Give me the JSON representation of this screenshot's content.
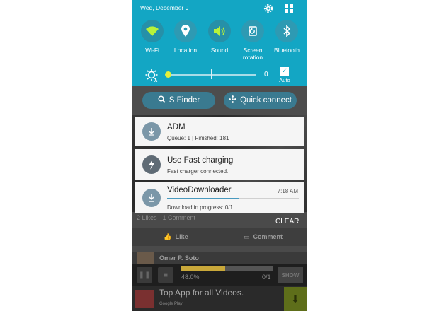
{
  "status": {
    "date": "Wed, December 9"
  },
  "quick_settings": [
    {
      "label": "Wi-Fi",
      "icon": "wifi-icon",
      "on": true
    },
    {
      "label": "Location",
      "icon": "location-icon",
      "on": false
    },
    {
      "label": "Sound",
      "icon": "sound-icon",
      "on": true
    },
    {
      "label": "Screen rotation",
      "icon": "screen-rotation-icon",
      "on": false
    },
    {
      "label": "Bluetooth",
      "icon": "bluetooth-icon",
      "on": false
    }
  ],
  "brightness": {
    "value": "0",
    "auto_label": "Auto",
    "auto_checked": true
  },
  "buttons": {
    "s_finder": "S Finder",
    "quick_connect": "Quick connect"
  },
  "notifications": [
    {
      "title": "ADM",
      "subtitle": "Queue: 1  |  Finished: 181",
      "icon": "adm-icon"
    },
    {
      "title": "Use Fast charging",
      "subtitle": "Fast charger connected.",
      "icon": "lightning-icon"
    },
    {
      "title": "VideoDownloader",
      "subtitle": "Download in progress: 0/1",
      "time": "7:18 AM",
      "icon": "download-icon",
      "progress": 0.55
    }
  ],
  "clear_label": "CLEAR",
  "background": {
    "likes": "2 Likes · 1 Comment",
    "like": "Like",
    "comment": "Comment",
    "user": "Omar P. Soto",
    "player": {
      "percent": "48.0%",
      "count": "0/1",
      "show": "SHOW",
      "progress": 0.48
    },
    "ad": {
      "title": "Top App for all Videos.",
      "store": "Google Play"
    }
  },
  "colors": {
    "shade": "#13a6c4",
    "button_pill": "#3a7a90",
    "notification_bg": "#f5f5f5",
    "icon_circle": "#7b97a8"
  }
}
